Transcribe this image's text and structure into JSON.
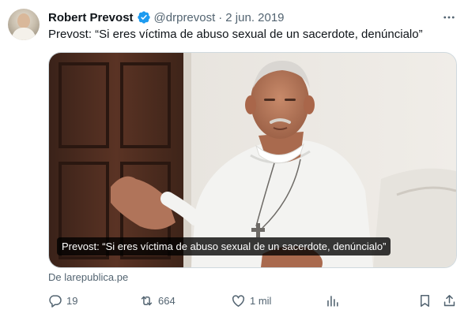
{
  "author": {
    "name": "Robert Prevost",
    "handle": "@drprevost",
    "separator": "·",
    "date": "2 jun. 2019",
    "verified_color": "#1d9bf0"
  },
  "tweet": {
    "text": "Prevost: “Si eres víctima de abuso sexual de un sacerdote, denúncialo”"
  },
  "card": {
    "caption": "Prevost: “Si eres víctima de abuso sexual de un sacerdote, denúncialo”",
    "source": "De larepublica.pe"
  },
  "actions": {
    "replies": "19",
    "retweets": "664",
    "likes": "1 mil"
  },
  "icons": {
    "more": "more-icon",
    "reply": "reply-icon",
    "retweet": "retweet-icon",
    "like": "heart-icon",
    "views": "views-icon",
    "bookmark": "bookmark-icon",
    "share": "share-icon"
  }
}
